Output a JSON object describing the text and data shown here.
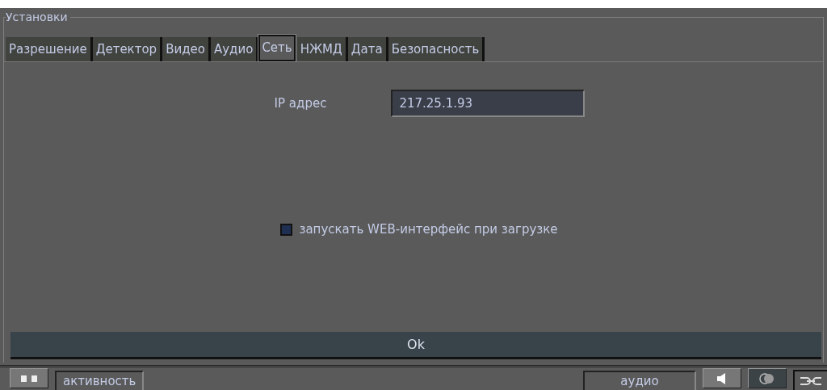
{
  "group": {
    "title": "Установки"
  },
  "tabs": [
    {
      "label": "Разрешение",
      "selected": false
    },
    {
      "label": "Детектор",
      "selected": false
    },
    {
      "label": "Видео",
      "selected": false
    },
    {
      "label": "Аудио",
      "selected": false
    },
    {
      "label": "Сеть",
      "selected": true
    },
    {
      "label": "НЖМД",
      "selected": false
    },
    {
      "label": "Дата",
      "selected": false
    },
    {
      "label": "Безопасность",
      "selected": false
    }
  ],
  "ip": {
    "label": "IP адрес",
    "value": "217.25.1.93"
  },
  "web_option": {
    "label": "запускать WEB-интерфейс при загрузке",
    "checked": false
  },
  "ok_button": "Ok",
  "status_bar": {
    "activity": "активность",
    "audio": "аудио"
  }
}
